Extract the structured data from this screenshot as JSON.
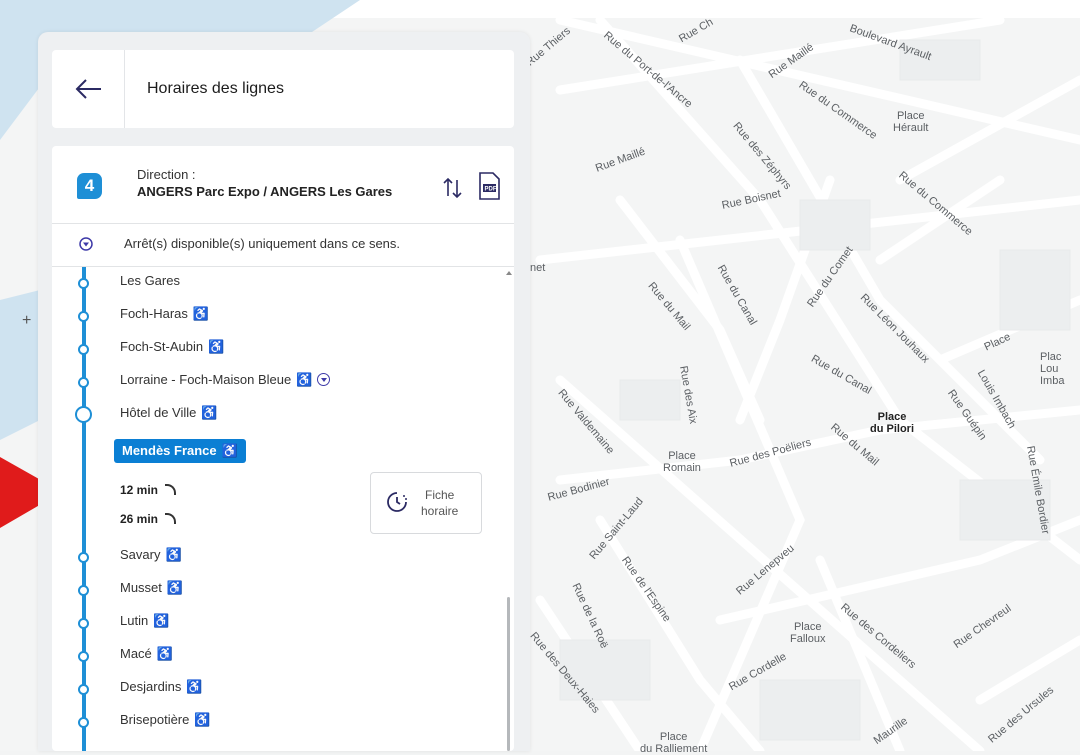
{
  "header": {
    "title": "Horaires des lignes",
    "back_icon": "arrow-left-icon"
  },
  "direction": {
    "line_number": "4",
    "label": "Direction :",
    "value": "ANGERS Parc Expo / ANGERS Les Gares",
    "swap_icon": "swap-vertical-icon",
    "pdf_icon": "pdf-icon"
  },
  "notice": {
    "text": "Arrêt(s) disponible(s) uniquement dans ce sens."
  },
  "stops": {
    "s0": "Les Gares",
    "s1": "Foch-Haras",
    "s2": "Foch-St-Aubin",
    "s3": "Lorraine - Foch-Maison Bleue",
    "s4": "Hôtel de Ville",
    "current": "Mendès France",
    "s6": "Savary",
    "s7": "Musset",
    "s8": "Lutin",
    "s9": "Macé",
    "s10": "Desjardins",
    "s11": "Brisepotière"
  },
  "next_departures": {
    "t1": "12 min",
    "t2": "26 min"
  },
  "fiche": {
    "line1": "Fiche",
    "line2": "horaire"
  },
  "map": {
    "labels": {
      "l1": "Rue Thiers",
      "l2": "Rue du Port-de-l'Ancre",
      "l3": "Rue Ch",
      "l4": "Boulevard Ayrault",
      "l5": "Rue Maillé",
      "l6": "Rue du Commerce",
      "l7": "Rue des Zéphyrs",
      "l8": "Rue Maillé",
      "l9": "Rue Boisnet",
      "l10": "Rue du Commerce",
      "l11": "Rue du Mail",
      "l12": "Rue du Canal",
      "l13": "Rue du Comet",
      "l14": "Rue Léon Jouhaux",
      "l15": "Place",
      "l16": "Rue du Canal",
      "l17": "Rue Valdemaine",
      "l18": "Rue des Aix",
      "l19": "Rue des Poëliers",
      "l20": "Rue du Mail",
      "l21": "Rue Guépin",
      "l22": "Rue Bodinier",
      "l23": "Rue Saint-Laud",
      "l24": "Rue Lenepveu",
      "l25": "Rue de l'Espine",
      "l26": "Rue de la Roë",
      "l27": "Rue des Deux-Haies",
      "l28": "Rue Cordelle",
      "l29": "Rue des Cordeliers",
      "l30": "Rue Chevreul",
      "l31": "Rue des Ursules",
      "l32": "Maurille",
      "l33": "Rue Émile Bordier",
      "l34": "Louis Imbach",
      "l35": "net"
    },
    "places": {
      "p1": "Place\nHérault",
      "p2": "Place\ndu Pilori",
      "p3": "Place\nRomain",
      "p4": "Place\nFalloux",
      "p5": "Place\ndu Ralliement",
      "p6": "Plac\nLou\nImba"
    }
  },
  "colors": {
    "line_blue": "#1e8fd6",
    "current_stop_bg": "#0b7fd4",
    "accessibility_icon": "#3e3aa8",
    "annotation_arrow": "#e01b1b"
  }
}
